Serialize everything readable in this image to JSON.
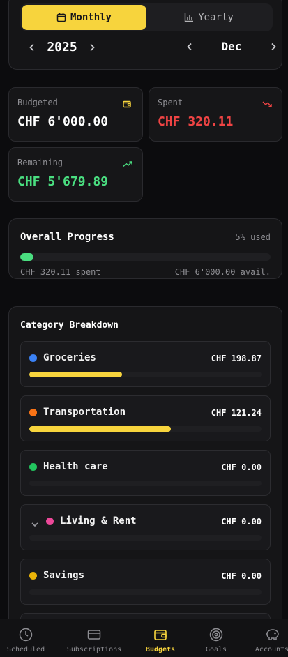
{
  "period": {
    "toggle": {
      "monthly_label": "Monthly",
      "yearly_label": "Yearly",
      "selected": "Monthly"
    },
    "year": "2025",
    "month": "Dec"
  },
  "stats": {
    "budgeted": {
      "label": "Budgeted",
      "value": "CHF 6'000.00",
      "icon": "wallet-icon",
      "color": "#ffffff",
      "icon_color": "#f7d43d"
    },
    "spent": {
      "label": "Spent",
      "value": "CHF 320.11",
      "icon": "trending-down-icon",
      "color": "#ef4444",
      "icon_color": "#ef4444"
    },
    "remaining": {
      "label": "Remaining",
      "value": "CHF 5'679.89",
      "icon": "trending-up-icon",
      "color": "#4ade80",
      "icon_color": "#4ade80"
    }
  },
  "overall": {
    "title": "Overall Progress",
    "used_text": "5% used",
    "progress": 0.053,
    "spent_text": "CHF 320.11 spent",
    "avail_text": "CHF 6'000.00 avail.",
    "bar_color": "#4ade80"
  },
  "categories": {
    "title": "Category Breakdown",
    "items": [
      {
        "name": "Groceries",
        "amount": "CHF 198.87",
        "dot_color": "#3b82f6",
        "progress": 0.4,
        "expandable": false
      },
      {
        "name": "Transportation",
        "amount": "CHF 121.24",
        "dot_color": "#f97316",
        "progress": 0.61,
        "expandable": false
      },
      {
        "name": "Health care",
        "amount": "CHF 0.00",
        "dot_color": "#22c55e",
        "progress": 0,
        "expandable": false
      },
      {
        "name": "Living & Rent",
        "amount": "CHF 0.00",
        "dot_color": "#ec4899",
        "progress": 0,
        "expandable": true
      },
      {
        "name": "Savings",
        "amount": "CHF 0.00",
        "dot_color": "#eab308",
        "progress": 0,
        "expandable": false
      }
    ],
    "bar_color": "#f7d43d"
  },
  "bottom_nav": {
    "tabs": [
      {
        "label": "Scheduled",
        "icon": "clock-icon",
        "active": false
      },
      {
        "label": "Subscriptions",
        "icon": "credit-card-icon",
        "active": false
      },
      {
        "label": "Budgets",
        "icon": "wallet-icon",
        "active": true
      },
      {
        "label": "Goals",
        "icon": "target-icon",
        "active": false
      },
      {
        "label": "Accounts",
        "icon": "piggy-bank-icon",
        "active": false
      }
    ]
  },
  "colors": {
    "accent": "#f7d43d",
    "background": "#0c0c0e",
    "card": "#151517"
  }
}
